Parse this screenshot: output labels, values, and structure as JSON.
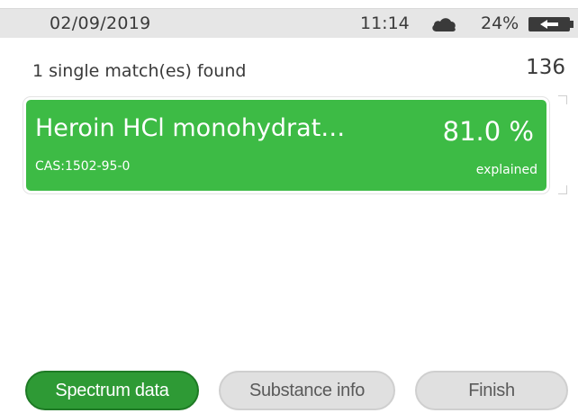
{
  "status_bar": {
    "date": "02/09/2019",
    "time": "11:14",
    "weather_icon": "cloud-icon",
    "battery_percent": "24%",
    "battery_icon": "battery-charging-icon"
  },
  "summary": {
    "text": "1 single match(es) found",
    "count": "136"
  },
  "result": {
    "name": "Heroin HCl monohydrat…",
    "cas": "CAS:1502-95-0",
    "percent": "81.0 %",
    "note": "explained",
    "color": "#3dbb45"
  },
  "buttons": {
    "spectrum_label": "Spectrum data",
    "substance_label": "Substance info",
    "finish_label": "Finish"
  },
  "colors": {
    "accent": "#2e9a35",
    "status_bar_bg": "#e6e6e6",
    "inactive_button": "#e0e0e0"
  }
}
